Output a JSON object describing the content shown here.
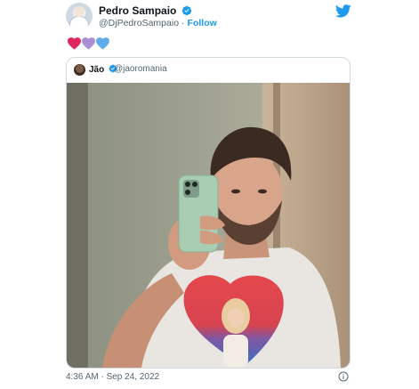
{
  "author": {
    "name": "Pedro Sampaio",
    "handle": "@DjPedroSampaio",
    "separator": "·",
    "follow_label": "Follow",
    "verified": true
  },
  "icons": {
    "brand": "twitter-bird-icon",
    "verified": "verified-badge-icon",
    "info": "info-icon"
  },
  "tweet_text": {
    "hearts": [
      "red-heart",
      "purple-heart",
      "blue-heart"
    ]
  },
  "quoted_tweet": {
    "name": "Jão",
    "handle": "@jaoromania",
    "verified": true,
    "media": "photo"
  },
  "footer": {
    "timestamp": "4:36 AM · Sep 24, 2022"
  },
  "colors": {
    "brand_blue": "#1d9bf0",
    "heart_red": "#e0245e",
    "heart_purple": "#aa8ed6",
    "heart_blue": "#5dadec",
    "text_secondary": "#536471",
    "border": "#cfd9de"
  }
}
